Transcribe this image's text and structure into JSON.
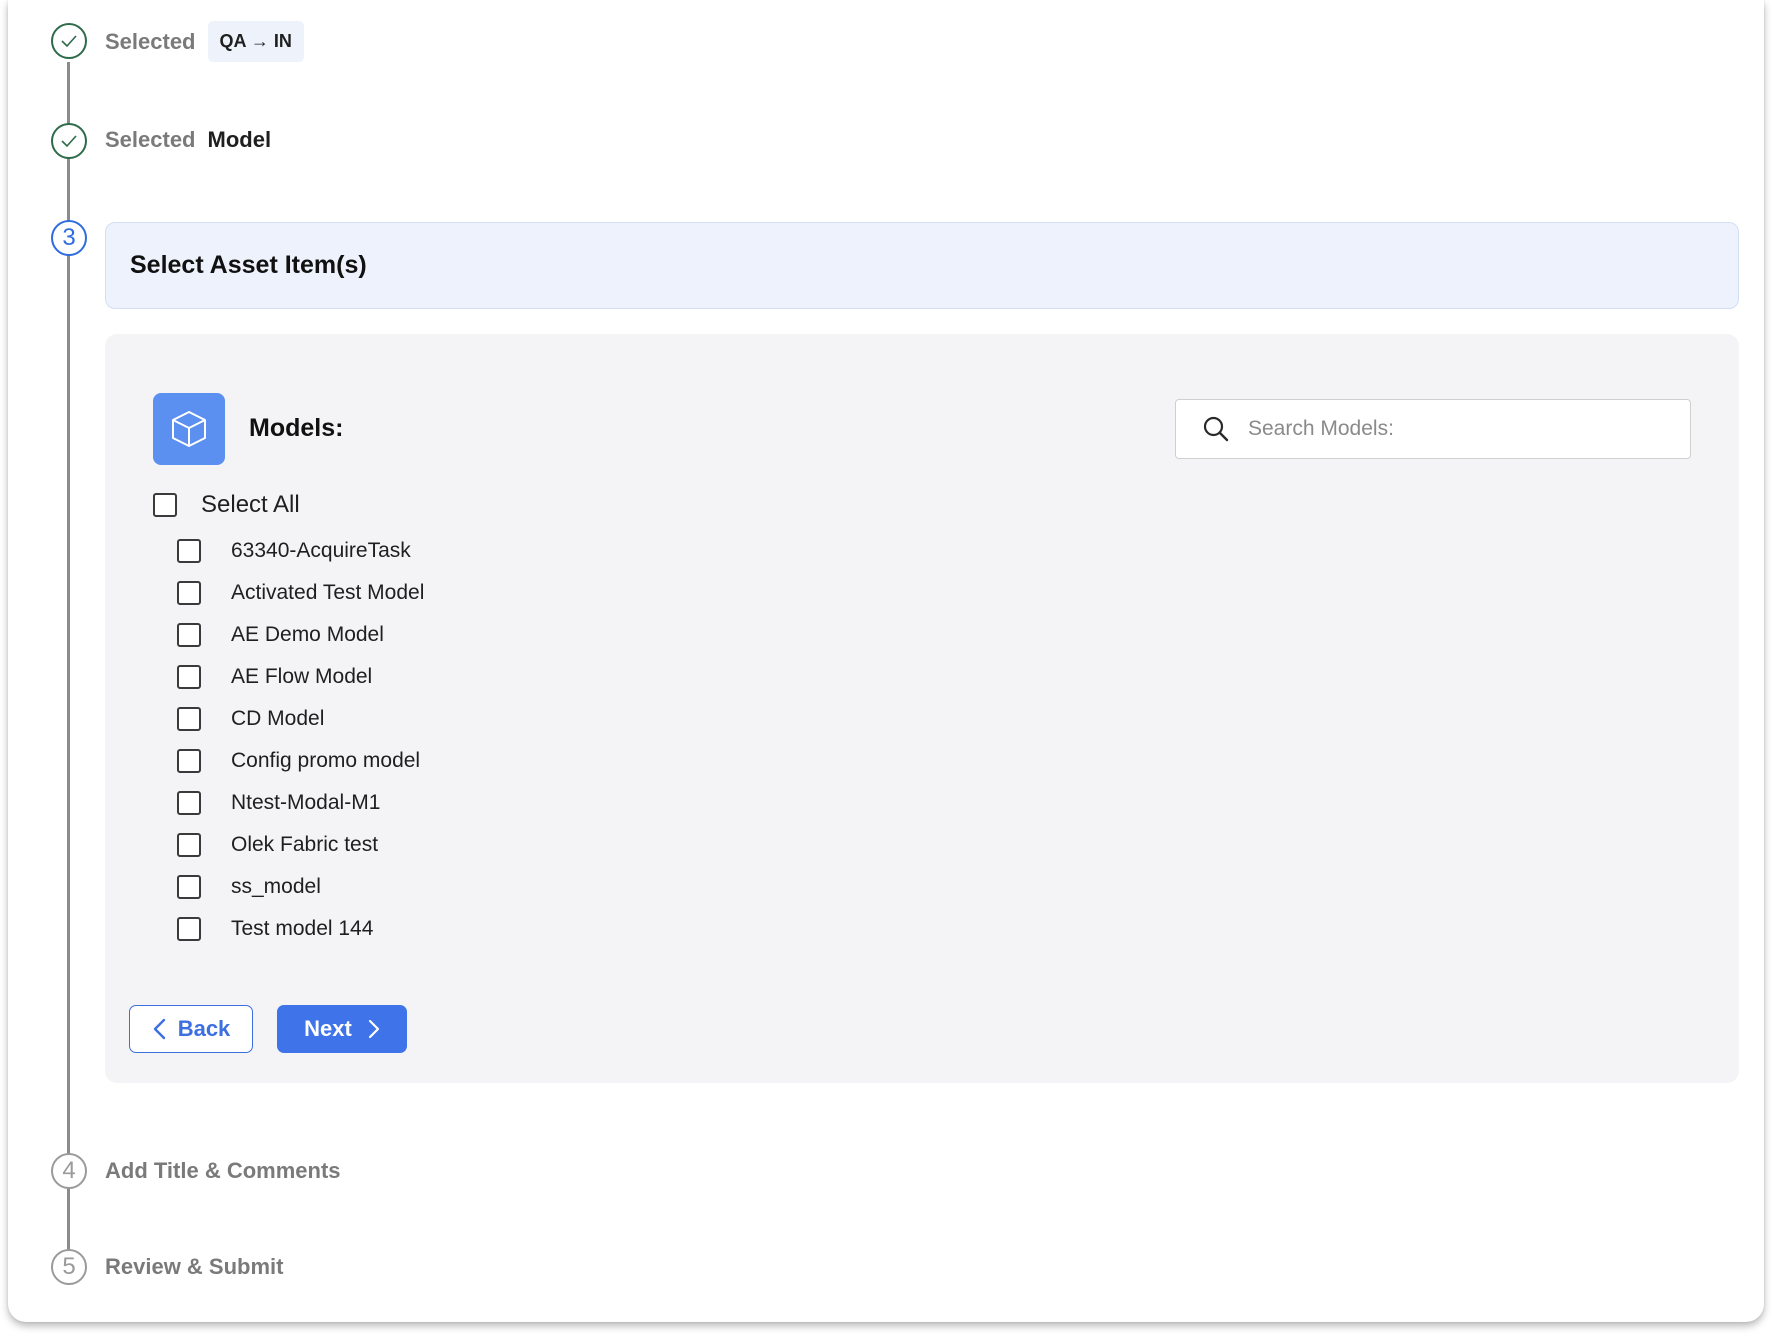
{
  "steps": [
    {
      "status": "done",
      "label": "Selected",
      "value": "QA → IN"
    },
    {
      "status": "done",
      "label": "Selected",
      "value": "Model"
    },
    {
      "status": "current",
      "number": "3",
      "title": "Select Asset Item(s)"
    },
    {
      "status": "pending",
      "number": "4",
      "title": "Add Title & Comments"
    },
    {
      "status": "pending",
      "number": "5",
      "title": "Review & Submit"
    }
  ],
  "panel": {
    "title": "Models:",
    "icon": "cube-icon",
    "search_placeholder": "Search Models:",
    "select_all_label": "Select All",
    "items": [
      {
        "label": "63340-AcquireTask",
        "checked": false
      },
      {
        "label": "Activated Test Model",
        "checked": false
      },
      {
        "label": "AE Demo Model",
        "checked": false
      },
      {
        "label": "AE Flow Model",
        "checked": false
      },
      {
        "label": "CD Model",
        "checked": false
      },
      {
        "label": "Config promo model",
        "checked": false
      },
      {
        "label": "Ntest-Modal-M1",
        "checked": false
      },
      {
        "label": "Olek Fabric test",
        "checked": false
      },
      {
        "label": "ss_model",
        "checked": false
      },
      {
        "label": "Test model 144",
        "checked": false
      }
    ],
    "back_label": "Back",
    "next_label": "Next"
  },
  "colors": {
    "accent": "#3f73ea",
    "done": "#2e6b4a",
    "pending": "#9a9a9a"
  }
}
